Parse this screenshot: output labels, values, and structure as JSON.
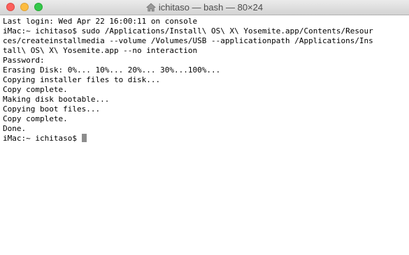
{
  "window": {
    "title": "ichitaso — bash — 80×24"
  },
  "terminal": {
    "lines": [
      "Last login: Wed Apr 22 16:00:11 on console",
      "iMac:~ ichitaso$ sudo /Applications/Install\\ OS\\ X\\ Yosemite.app/Contents/Resour",
      "ces/createinstallmedia --volume /Volumes/USB --applicationpath /Applications/Ins",
      "tall\\ OS\\ X\\ Yosemite.app --no interaction",
      "Password:",
      "Erasing Disk: 0%... 10%... 20%... 30%...100%...",
      "Copying installer files to disk...",
      "Copy complete.",
      "Making disk bootable...",
      "Copying boot files...",
      "Copy complete.",
      "Done."
    ],
    "prompt": "iMac:~ ichitaso$ "
  },
  "colors": {
    "close": "#fc605c",
    "minimize": "#fdbc40",
    "maximize": "#34c84a",
    "cursor": "#8c8c8c"
  },
  "icons": {
    "title_icon": "home-icon"
  }
}
